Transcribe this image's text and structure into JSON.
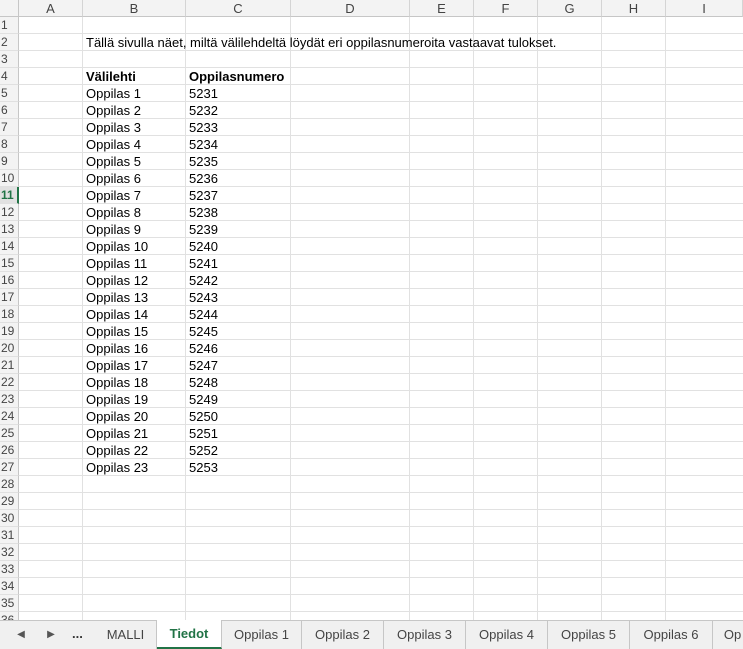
{
  "columns": [
    "A",
    "B",
    "C",
    "D",
    "E",
    "F",
    "G",
    "H",
    "I"
  ],
  "rows": [
    "1",
    "2",
    "3",
    "4",
    "5",
    "6",
    "7",
    "8",
    "9",
    "10",
    "11",
    "12",
    "13",
    "14",
    "15",
    "16",
    "17",
    "18",
    "19",
    "20",
    "21",
    "22",
    "23",
    "24",
    "25",
    "26",
    "27",
    "28",
    "29",
    "30",
    "31",
    "32",
    "33",
    "34",
    "35",
    "36"
  ],
  "active_row": "11",
  "intro_text": "Tällä sivulla näet, miltä välilehdeltä löydät eri oppilasnumeroita vastaavat tulokset.",
  "table": {
    "headers": [
      "Välilehti",
      "Oppilasnumero"
    ],
    "rows": [
      [
        "Oppilas 1",
        "5231"
      ],
      [
        "Oppilas 2",
        "5232"
      ],
      [
        "Oppilas 3",
        "5233"
      ],
      [
        "Oppilas 4",
        "5234"
      ],
      [
        "Oppilas 5",
        "5235"
      ],
      [
        "Oppilas 6",
        "5236"
      ],
      [
        "Oppilas 7",
        "5237"
      ],
      [
        "Oppilas 8",
        "5238"
      ],
      [
        "Oppilas 9",
        "5239"
      ],
      [
        "Oppilas 10",
        "5240"
      ],
      [
        "Oppilas 11",
        "5241"
      ],
      [
        "Oppilas 12",
        "5242"
      ],
      [
        "Oppilas 13",
        "5243"
      ],
      [
        "Oppilas 14",
        "5244"
      ],
      [
        "Oppilas 15",
        "5245"
      ],
      [
        "Oppilas 16",
        "5246"
      ],
      [
        "Oppilas 17",
        "5247"
      ],
      [
        "Oppilas 18",
        "5248"
      ],
      [
        "Oppilas 19",
        "5249"
      ],
      [
        "Oppilas 20",
        "5250"
      ],
      [
        "Oppilas 21",
        "5251"
      ],
      [
        "Oppilas 22",
        "5252"
      ],
      [
        "Oppilas 23",
        "5253"
      ]
    ]
  },
  "tabbar": {
    "more_label": "...",
    "active_tab": "Tiedot",
    "tabs": [
      "MALLI",
      "Tiedot",
      "Oppilas 1",
      "Oppilas 2",
      "Oppilas 3",
      "Oppilas 4",
      "Oppilas 5",
      "Oppilas 6",
      "Op"
    ],
    "prev_icon": "triangle-left-icon",
    "next_icon": "triangle-right-icon"
  },
  "colors": {
    "accent": "#217346",
    "header_bg": "#f3f3f3",
    "gridline": "#e1e1e1"
  }
}
